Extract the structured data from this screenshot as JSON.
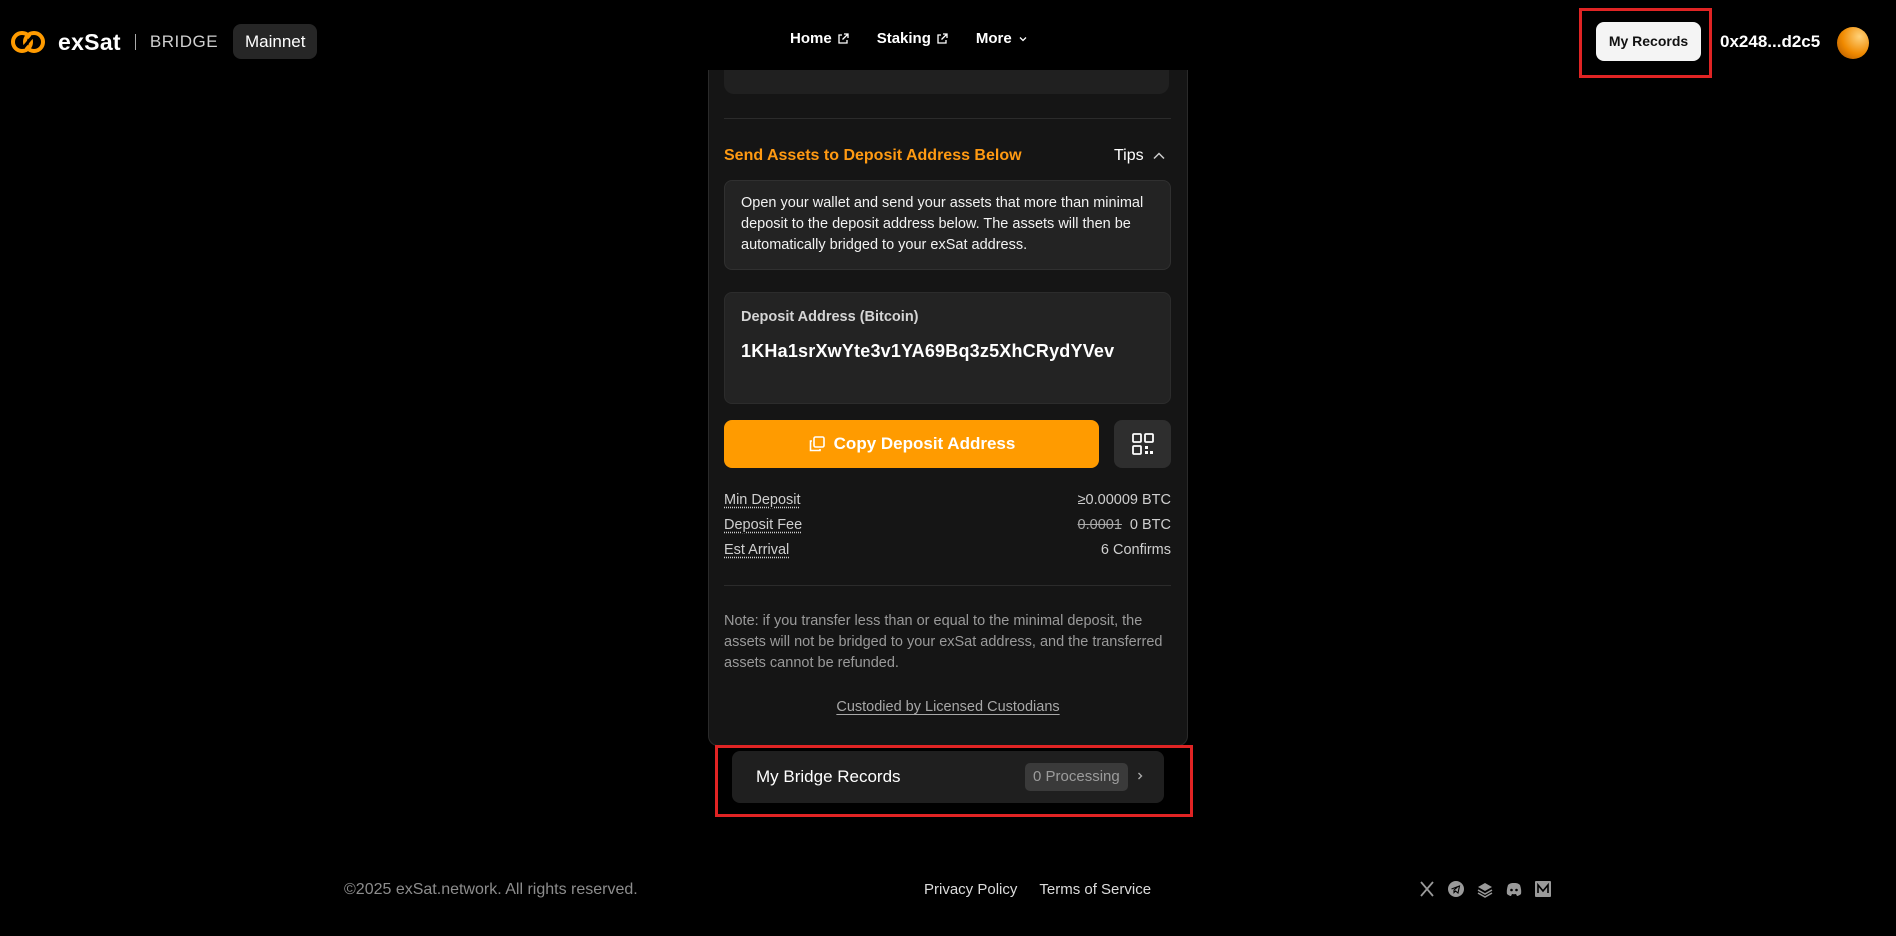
{
  "header": {
    "brand": "exSat",
    "product": "BRIDGE",
    "network": "Mainnet",
    "nav": [
      {
        "label": "Home",
        "icon": "external-link-icon"
      },
      {
        "label": "Staking",
        "icon": "external-link-icon"
      },
      {
        "label": "More",
        "icon": "chevron-down-icon"
      }
    ],
    "records_button": "My Records",
    "wallet_address": "0x248...d2c5"
  },
  "deposit": {
    "section_title": "Send Assets to Deposit Address Below",
    "tips_label": "Tips",
    "tip_text": "Open your wallet and send your assets that more than minimal deposit to the deposit address below. The assets will then be automatically bridged to your exSat address.",
    "address_label": "Deposit Address (Bitcoin)",
    "address": "1KHa1srXwYte3v1YA69Bq3z5XhCRydYVev",
    "copy_button": "Copy Deposit Address",
    "info": {
      "min_deposit_label": "Min Deposit",
      "min_deposit_value": "≥0.00009 BTC",
      "fee_label": "Deposit Fee",
      "fee_old": "0.0001",
      "fee_value": "0 BTC",
      "arrival_label": "Est Arrival",
      "arrival_value": "6 Confirms"
    },
    "note": "Note: if you transfer less than or equal to the minimal deposit, the assets will not be bridged to your exSat address, and the transferred assets cannot be refunded.",
    "custodian_link": "Custodied by Licensed Custodians"
  },
  "bridge_records": {
    "label": "My Bridge Records",
    "status": "0 Processing"
  },
  "footer": {
    "copyright": "©2025 exSat.network. All rights reserved.",
    "links": [
      "Privacy Policy",
      "Terms of Service"
    ],
    "socials": [
      "x-icon",
      "telegram-icon",
      "gitbook-icon",
      "discord-icon",
      "medium-icon"
    ]
  },
  "colors": {
    "accent": "#ff9b00",
    "highlight_outline": "#e02424",
    "background": "#000000"
  }
}
